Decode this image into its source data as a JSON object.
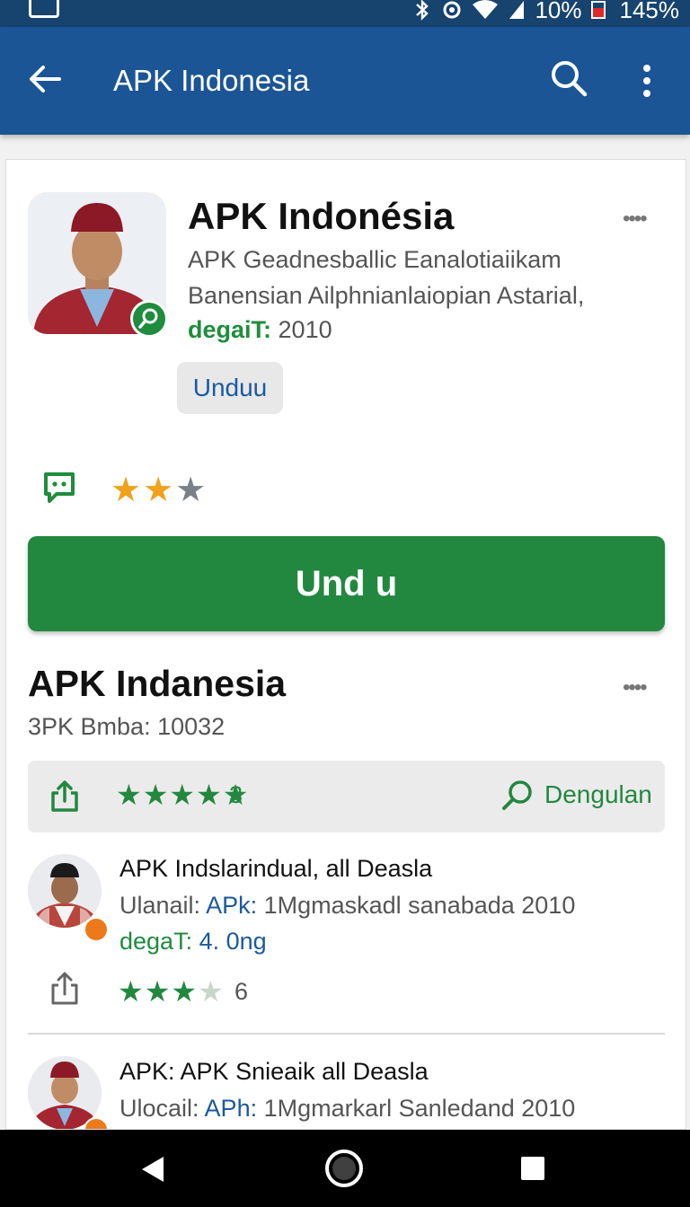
{
  "status_bar": {
    "wifi_level": "10%",
    "battery_level": "145%",
    "icons": [
      "gallery-icon",
      "bluetooth-icon",
      "sync-icon",
      "wifi-icon",
      "signal-icon",
      "battery-icon"
    ]
  },
  "app_bar": {
    "title": "APK Indonesia",
    "icons": [
      "back-arrow-icon",
      "search-icon",
      "more-vert-icon"
    ]
  },
  "header": {
    "title": "APK Indonésia",
    "more_label": "••••",
    "desc_line1": "APK Geadnesballic Eanalotiaiikam",
    "desc_line2": "Banensian Ailphnianlaiopian Astarial,",
    "date_label": "degaiT:",
    "date_value": "2010",
    "chip_label": "Unduu"
  },
  "rating": {
    "filled": 2,
    "total": 3,
    "colors": {
      "filled": "#f0a21b",
      "empty": "#7a7f88"
    }
  },
  "primary_button": {
    "label": "Und u",
    "color": "#22883f"
  },
  "section2": {
    "title": "APK Indanesia",
    "more_label": "••••",
    "subtitle": "3PK Bmba: 10032",
    "info_bar": {
      "stars": 5,
      "count": "3",
      "link_label": "Dengulan"
    }
  },
  "reviews": [
    {
      "title": "APK Indslarindual, all Deasla",
      "meta_prefix": "Ulanail: ",
      "meta_highlight": "APk:",
      "meta_suffix": " 1Mgmaskadl sanabada 2010",
      "date_label": "degaT:",
      "date_value": " 4. 0ng",
      "stars": 3.5,
      "count": "6"
    },
    {
      "title": "APK: APK Snieaik all Deasla",
      "meta_prefix": "Ulocail: ",
      "meta_highlight": "APh:",
      "meta_suffix": " 1Mgmarkarl Sanledand 2010"
    }
  ],
  "nav_bar": {
    "icons": [
      "nav-back-icon",
      "nav-home-icon",
      "nav-recents-icon"
    ]
  },
  "theme": {
    "app_bar": "#1b5595",
    "status_bar": "#17436f",
    "accent_green": "#22883f",
    "link_blue": "#1b5aa0"
  }
}
